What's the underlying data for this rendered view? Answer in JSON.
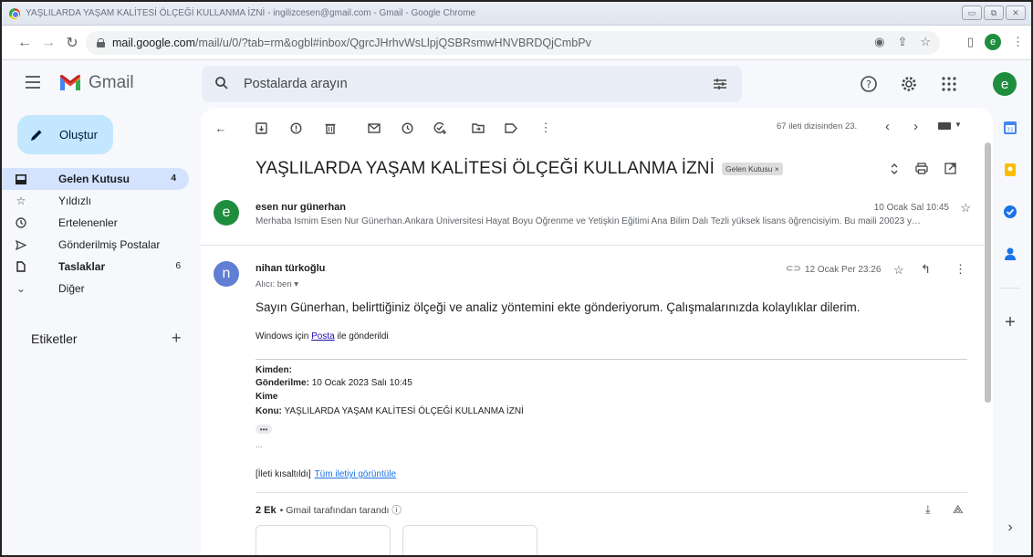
{
  "window": {
    "title": "YAŞLILARDA YAŞAM KALİTESİ ÖLÇEĞİ KULLANMA İZNİ - ingilizcesen@gmail.com - Gmail - Google Chrome"
  },
  "browser": {
    "url_host": "mail.google.com",
    "url_path": "/mail/u/0/?tab=rm&ogbl#inbox/QgrcJHrhvWsLlpjQSBRsmwHNVBRDQjCmbPv",
    "profile_initial": "e"
  },
  "header": {
    "app_name": "Gmail",
    "search_placeholder": "Postalarda arayın",
    "avatar_initial": "e"
  },
  "sidebar": {
    "compose_label": "Oluştur",
    "items": [
      {
        "label": "Gelen Kutusu",
        "count": "4",
        "icon": "inbox-icon"
      },
      {
        "label": "Yıldızlı",
        "count": "",
        "icon": "star-icon"
      },
      {
        "label": "Ertelenenler",
        "count": "",
        "icon": "clock-icon"
      },
      {
        "label": "Gönderilmiş Postalar",
        "count": "",
        "icon": "send-icon"
      },
      {
        "label": "Taslaklar",
        "count": "6",
        "icon": "draft-icon"
      },
      {
        "label": "Diğer",
        "count": "",
        "icon": "chevron-down-icon"
      }
    ],
    "labels_title": "Etiketler"
  },
  "toolbar": {
    "pager_text": "67 ileti dizisinden 23."
  },
  "thread": {
    "subject": "YAŞLILARDA YAŞAM KALİTESİ ÖLÇEĞİ KULLANMA İZNİ",
    "label_chip": "Gelen Kutusu ×",
    "messages": [
      {
        "avatar": "e",
        "avatar_color": "#1e8e3e",
        "sender": "esen nur günerhan",
        "date": "10 Ocak Sal 10:45",
        "snippet": "Merhaba İsmim Esen Nur Günerhan.Ankara Üniversitesi Hayat Boyu Öğrenme ve Yetişkin Eğitimi Ana Bilim Dalı Tezli yüksek lisans öğrencisiyim. Bu maili 20023 y…"
      },
      {
        "avatar": "n",
        "avatar_color": "#5f7ed4",
        "sender": "nihan türkoğlu",
        "date": "12 Ocak Per 23:26",
        "to_line": "Alıcı: ben ▾",
        "body": "Sayın Günerhan, belirttiğiniz ölçeği ve analiz yöntemini ekte gönderiyorum. Çalışmalarınızda kolaylıklar dilerim.",
        "sent_from_prefix": "Windows için ",
        "sent_from_link": "Posta",
        "sent_from_suffix": " ile gönderildi",
        "quote_from_label": "Kimden:",
        "quote_sent_label": "Gönderilme:",
        "quote_sent_value": "10 Ocak 2023 Salı 10:45",
        "quote_to_label": "Kime",
        "quote_subject_label": "Konu:",
        "quote_subject_value": "YAŞLILARDA YAŞAM KALİTESİ ÖLÇEĞİ KULLANMA İZNİ",
        "quote_dots": "•••",
        "ellipsis": "...",
        "clipped_text": "[İleti kısaltıldı]",
        "clipped_link": "Tüm iletiyi görüntüle"
      }
    ],
    "attachments": {
      "count_label": "2 Ek",
      "scan_text": "• Gmail tarafından tarandı ⓘ"
    }
  },
  "colors": {
    "compose_bg": "#c2e7ff",
    "active_nav_bg": "#d3e3fd",
    "link": "#1a73e8"
  }
}
